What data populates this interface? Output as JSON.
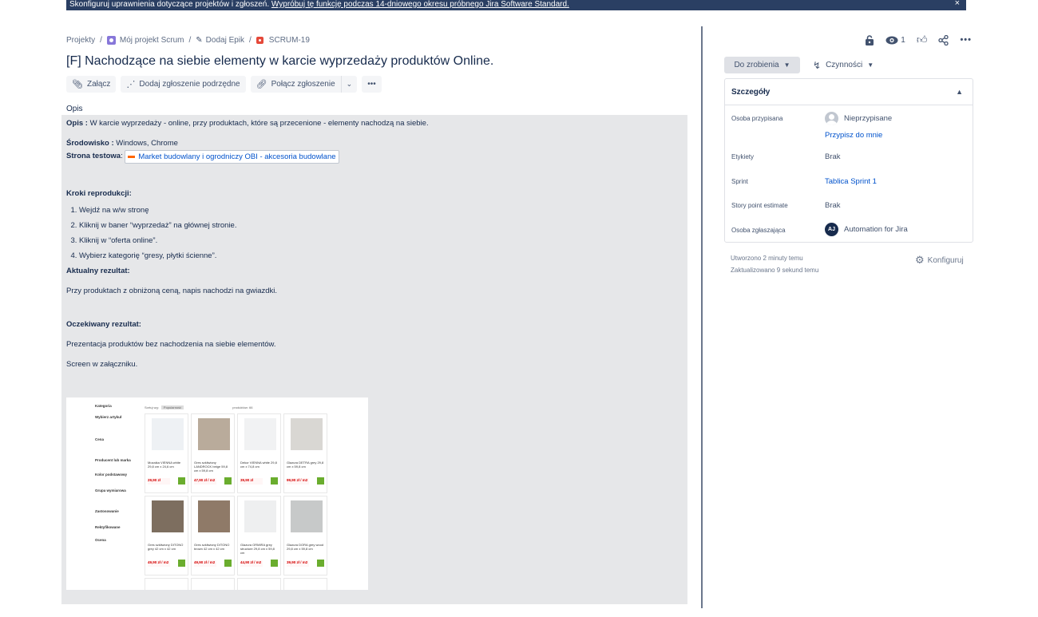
{
  "banner": {
    "text": "Skonfiguruj uprawnienia dotyczące projektów i zgłoszeń.",
    "link": "Wypróbuj tę funkcję podczas 14-dniowego okresu próbnego Jira Software Standard.",
    "close": "×"
  },
  "breadcrumb": {
    "projects": "Projekty",
    "sep": "/",
    "project": "Mój projekt Scrum",
    "epic": "Dodaj Epik",
    "issue_key": "SCRUM-19"
  },
  "issue": {
    "title": "[F] Nachodzące na siebie elementy w karcie wyprzedaży produktów Online."
  },
  "toolbar": {
    "attach": "Załącz",
    "add_child": "Dodaj zgłoszenie podrzędne",
    "link_issue": "Połącz zgłoszenie",
    "chevron": "⌄",
    "more": "•••"
  },
  "description": {
    "heading": "Opis",
    "opis_label": "Opis :",
    "opis_text": "W karcie wyprzedaży - online, przy produktach, które są przecenione - elementy nachodzą na siebie.",
    "env_label": "Środowisko :",
    "env_text": "Windows, Chrome",
    "site_label": "Strona testowa",
    "site_link": "Market budowlany i ogrodniczy OBI - akcesoria budowlane",
    "steps_label": "Kroki reprodukcji:",
    "steps": [
      "Wejdź na w/w stronę",
      "Kliknij w baner “wyprzedaż” na głównej stronie.",
      "Kliknij w “oferta online”.",
      "Wybierz kategorię “gresy, płytki ścienne”."
    ],
    "actual_label": "Aktualny rezultat:",
    "actual_text": "Przy produktach z obniżoną ceną, napis nachodzi na gwiazdki.",
    "expected_label": "Oczekiwany rezultat:",
    "expected_text": "Prezentacja produktów bez nachodzenia na siebie elementów.",
    "screen_note": "Screen w załączniku."
  },
  "attachment": {
    "sidebar": [
      "Kategoria",
      "Wybierz artykuł",
      "Cena",
      "Producent lub marka",
      "Kolor podstawowy",
      "Grupa wymiarowa",
      "Zastosowanie",
      "Rektyfikowane",
      "Ocena"
    ],
    "sort_label": "Sortuj wg:",
    "sort_value": "Popularność",
    "products_label": "produktów: 66",
    "tiles": [
      {
        "name": "Mozaika VIENNA white 29,8 cm x 24,6 cm",
        "price": "29,90 zł",
        "color": "#eef1f4"
      },
      {
        "name": "Gres szkliwiony LANDROCK beige 59,8 cm x 59,8 cm",
        "price": "47,90 zł / m2",
        "color": "#b9ab9b"
      },
      {
        "name": "Dekor VIENNA white 29,8 cm x 74,8 cm",
        "price": "39,90 zł",
        "color": "#f1f2f3"
      },
      {
        "name": "Glazura DETRA grey 29,8 cm x 59,8 cm",
        "price": "99,90 zł / m2",
        "color": "#d9d7d3"
      },
      {
        "name": "Gres szkliwiony DITONO grey 42 cm x 42 cm",
        "price": "49,90 zł / m2",
        "color": "#7d6e5f"
      },
      {
        "name": "Gres szkliwiony DITONO brown 42 cm x 42 cm",
        "price": "49,90 zł / m2",
        "color": "#8f7a68"
      },
      {
        "name": "Glazura ORMIRA grey structure 29,8 cm x 59,8 cm",
        "price": "44,90 zł / m2",
        "color": "#eeeff0"
      },
      {
        "name": "Glazura DORA grey wood 29,8 cm x 59,8 cm",
        "price": "39,90 zł / m2",
        "color": "#c7c9c9"
      }
    ]
  },
  "top_actions": {
    "watchers": "1"
  },
  "status": {
    "label": "Do zrobienia"
  },
  "actions": {
    "label": "Czynności"
  },
  "details": {
    "heading": "Szczegóły",
    "assignee_label": "Osoba przypisana",
    "assignee_value": "Nieprzypisane",
    "assign_me": "Przypisz do mnie",
    "labels_label": "Etykiety",
    "labels_value": "Brak",
    "sprint_label": "Sprint",
    "sprint_value": "Tablica Sprint 1",
    "story_label": "Story point estimate",
    "story_value": "Brak",
    "reporter_label": "Osoba zgłaszająca",
    "reporter_initials": "AJ",
    "reporter_value": "Automation for Jira"
  },
  "meta": {
    "created": "Utworzono 2 minuty temu",
    "updated": "Zaktualizowano 9 sekund temu",
    "configure": "Konfiguruj"
  },
  "colors": {
    "banner_bg": "#2a3f63",
    "link": "#0052cc",
    "text": "#172b4d",
    "description_bg": "#e6e7e9",
    "bug_icon": "#e5493a",
    "project_icon": "#8777d9"
  }
}
